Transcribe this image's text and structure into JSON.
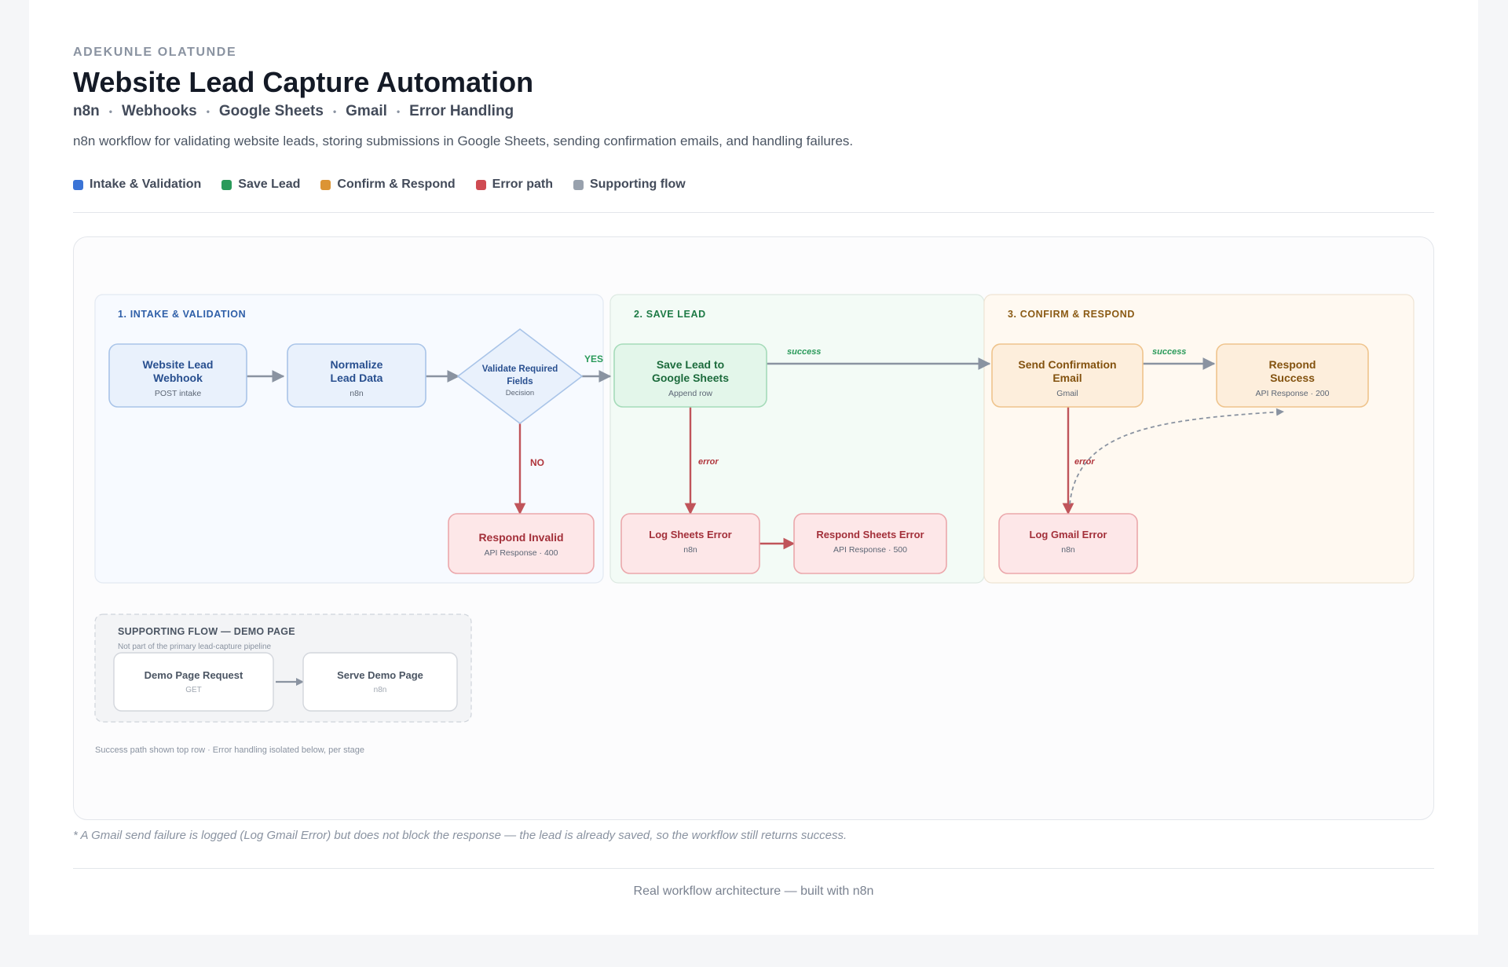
{
  "header": {
    "author": "ADEKUNLE OLATUNDE",
    "title": "Website Lead Capture Automation",
    "tags": [
      "n8n",
      "Webhooks",
      "Google Sheets",
      "Gmail",
      "Error Handling"
    ],
    "description": "n8n workflow for validating website leads, storing submissions in Google Sheets, sending confirmation emails, and handling failures."
  },
  "legend": [
    {
      "label": "Intake & Validation",
      "color": "#3b74d6"
    },
    {
      "label": "Save Lead",
      "color": "#2a9a5a"
    },
    {
      "label": "Confirm & Respond",
      "color": "#dc9434"
    },
    {
      "label": "Error path",
      "color": "#cf4b52"
    },
    {
      "label": "Supporting flow",
      "color": "#98a1ad"
    }
  ],
  "colors": {
    "blue": "#2f5fa8",
    "green": "#1d7a45",
    "orange": "#8a5a14",
    "red": "#b0353c",
    "gray": "#8a93a1"
  },
  "sections": {
    "intake": "1. INTAKE & VALIDATION",
    "save": "2. SAVE LEAD",
    "confirm": "3. CONFIRM & RESPOND",
    "supporting_title": "SUPPORTING FLOW — DEMO PAGE",
    "supporting_subtitle": "Not part of the primary lead-capture pipeline"
  },
  "nodes": {
    "webhook": {
      "title": [
        "Website Lead",
        "Webhook"
      ],
      "sub": "POST intake"
    },
    "normalize": {
      "title": [
        "Normalize",
        "Lead Data"
      ],
      "sub": "n8n"
    },
    "validate": {
      "title": [
        "Validate Required",
        "Fields"
      ],
      "sub": "Decision"
    },
    "respond_invalid": {
      "title": [
        "Respond Invalid"
      ],
      "sub": "API Response · 400"
    },
    "save_sheets": {
      "title": [
        "Save Lead to",
        "Google Sheets"
      ],
      "sub": "Append row"
    },
    "log_sheets_error": {
      "title": [
        "Log Sheets Error"
      ],
      "sub": "n8n"
    },
    "respond_sheets_error": {
      "title": [
        "Respond Sheets Error"
      ],
      "sub": "API Response · 500"
    },
    "send_email": {
      "title": [
        "Send Confirmation",
        "Email"
      ],
      "sub": "Gmail"
    },
    "respond_success": {
      "title": [
        "Respond",
        "Success"
      ],
      "sub": "API Response · 200"
    },
    "log_gmail_error": {
      "title": [
        "Log Gmail Error"
      ],
      "sub": "n8n"
    },
    "demo_request": {
      "title": [
        "Demo Page Request"
      ],
      "sub": "GET"
    },
    "serve_demo": {
      "title": [
        "Serve Demo Page"
      ],
      "sub": "n8n"
    }
  },
  "edge_labels": {
    "yes": "YES",
    "no": "NO",
    "success": "success",
    "error": "error"
  },
  "caption": "Success path shown top row · Error handling isolated below, per stage",
  "footnote": "* A Gmail send failure is logged (Log Gmail Error) but does not block the response — the lead is already saved, so the workflow still returns success.",
  "footer": "Real workflow architecture — built with n8n"
}
